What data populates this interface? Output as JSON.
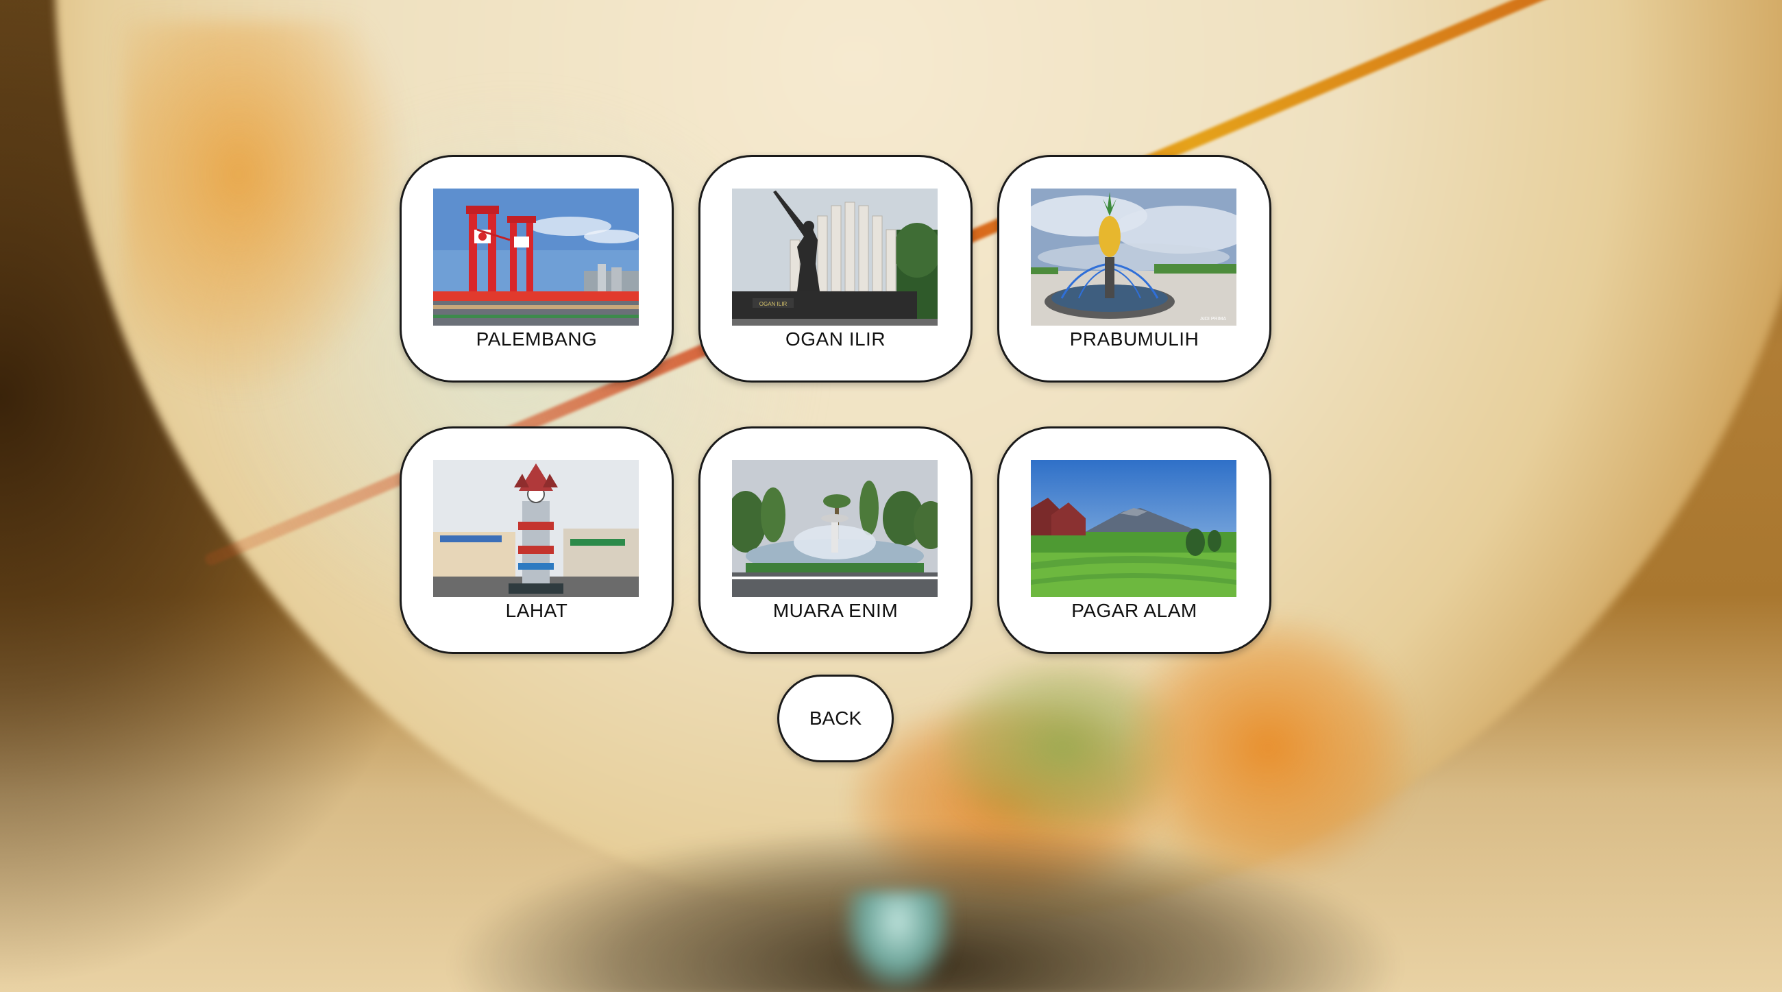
{
  "destinations": [
    {
      "label": "PALEMBANG",
      "image": "ampera-bridge-photo"
    },
    {
      "label": "OGAN ILIR",
      "image": "soldier-monument-photo"
    },
    {
      "label": "PRABUMULIH",
      "image": "pineapple-fountain-photo"
    },
    {
      "label": "LAHAT",
      "image": "clock-tower-photo"
    },
    {
      "label": "MUARA ENIM",
      "image": "roundabout-fountain-photo"
    },
    {
      "label": "PAGAR ALAM",
      "image": "mountain-tea-field-photo"
    }
  ],
  "navigation": {
    "back_label": "BACK"
  },
  "background": {
    "image": "blurred-globe-photo"
  },
  "colors": {
    "card_bg": "#ffffff",
    "card_border": "#1a1a1a",
    "text": "#111111"
  }
}
